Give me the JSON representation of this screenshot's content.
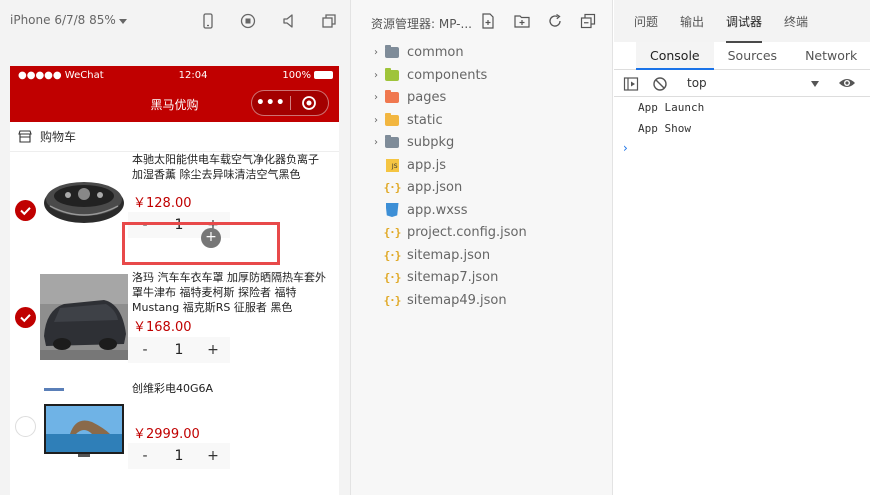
{
  "simulator": {
    "device": "iPhone 6/7/8 85%",
    "status_bar": {
      "carrier": "●●●●● WeChat",
      "time": "12:04",
      "battery": "100%"
    },
    "nav_title": "黑马优购",
    "capsule_dots": "•••",
    "cart_header": "购物车",
    "items": [
      {
        "name_line1": "本驰太阳能供电车载空气净化器负离子",
        "name_line2": "加湿香薰 除尘去异味清洁空气黑色",
        "price": "￥128.00",
        "count": "1",
        "checked": true,
        "minus": "-",
        "plus": "+"
      },
      {
        "name_line1": "洛玛 汽车车衣车罩 加厚防晒隔热车套外",
        "name_line2": "罩牛津布 福特麦柯斯 探险者 福特",
        "name_line3": "Mustang 福克斯RS 征服者 黑色",
        "price": "￥168.00",
        "count": "1",
        "checked": true,
        "minus": "-",
        "plus": "+"
      },
      {
        "name_line1": "创维彩电40G6A",
        "price": "￥2999.00",
        "count": "1",
        "checked": false,
        "minus": "-",
        "plus": "+"
      }
    ],
    "accent_color": "#c00000"
  },
  "explorer": {
    "title": "资源管理器: MP-...",
    "tree": [
      {
        "name": "common",
        "type": "folder",
        "color": "#7f8c99"
      },
      {
        "name": "components",
        "type": "folder",
        "color": "#9fc43a"
      },
      {
        "name": "pages",
        "type": "folder",
        "color": "#f0784f"
      },
      {
        "name": "static",
        "type": "folder",
        "color": "#f2b640"
      },
      {
        "name": "subpkg",
        "type": "folder",
        "color": "#7f8c99"
      },
      {
        "name": "app.js",
        "type": "js"
      },
      {
        "name": "app.json",
        "type": "json"
      },
      {
        "name": "app.wxss",
        "type": "css"
      },
      {
        "name": "project.config.json",
        "type": "json"
      },
      {
        "name": "sitemap.json",
        "type": "json"
      },
      {
        "name": "sitemap7.json",
        "type": "json"
      },
      {
        "name": "sitemap49.json",
        "type": "json"
      }
    ]
  },
  "devtools": {
    "top_tabs": [
      "问题",
      "输出",
      "调试器",
      "终端"
    ],
    "active_top_tab": "调试器",
    "sub_tabs": [
      "Console",
      "Sources",
      "Network"
    ],
    "active_sub_tab": "Console",
    "context": "top",
    "logs": [
      "App Launch",
      "App Show"
    ],
    "prompt": "›"
  }
}
